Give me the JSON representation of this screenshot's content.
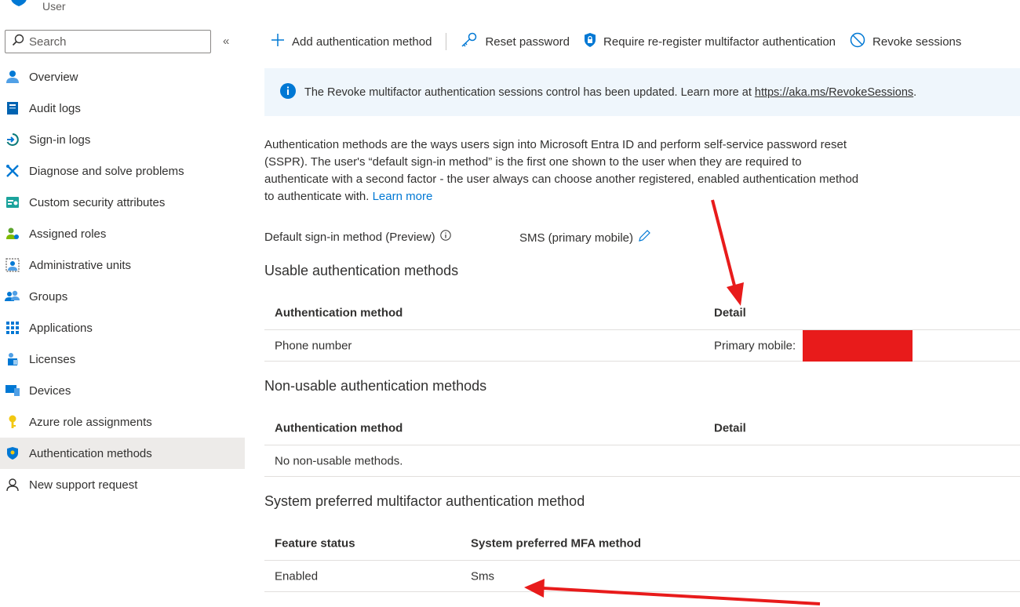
{
  "header": {
    "subtitle": "User"
  },
  "sidebar": {
    "search_placeholder": "Search",
    "collapse_glyph": "«",
    "items": [
      {
        "label": "Overview",
        "icon": "person-icon"
      },
      {
        "label": "Audit logs",
        "icon": "audit-log-icon"
      },
      {
        "label": "Sign-in logs",
        "icon": "sign-in-icon"
      },
      {
        "label": "Diagnose and solve problems",
        "icon": "wrench-icon"
      },
      {
        "label": "Custom security attributes",
        "icon": "attribute-card-icon"
      },
      {
        "label": "Assigned roles",
        "icon": "roles-icon"
      },
      {
        "label": "Administrative units",
        "icon": "admin-units-icon"
      },
      {
        "label": "Groups",
        "icon": "groups-icon"
      },
      {
        "label": "Applications",
        "icon": "apps-grid-icon"
      },
      {
        "label": "Licenses",
        "icon": "license-icon"
      },
      {
        "label": "Devices",
        "icon": "device-icon"
      },
      {
        "label": "Azure role assignments",
        "icon": "key-icon"
      },
      {
        "label": "Authentication methods",
        "icon": "auth-shield-icon",
        "active": true
      },
      {
        "label": "New support request",
        "icon": "support-person-icon"
      }
    ]
  },
  "toolbar": {
    "add": "Add authentication method",
    "reset": "Reset password",
    "require": "Require re-register multifactor authentication",
    "revoke": "Revoke sessions"
  },
  "banner": {
    "text": "The Revoke multifactor authentication sessions control has been updated. Learn more at",
    "link": "https://aka.ms/RevokeSessions",
    "trailing": "."
  },
  "description": {
    "text": "Authentication methods are the ways users sign into Microsoft Entra ID and perform self-service password reset (SSPR). The user's “default sign-in method” is the first one shown to the user when they are required to authenticate with a second factor - the user always can choose another registered, enabled authentication method to authenticate with.",
    "link": "Learn more"
  },
  "default_signin": {
    "label": "Default sign-in method (Preview)",
    "value": "SMS (primary mobile)"
  },
  "usable": {
    "title": "Usable authentication methods",
    "headers": [
      "Authentication method",
      "Detail"
    ],
    "rows": [
      {
        "method": "Phone number",
        "detail": "Primary mobile:"
      }
    ]
  },
  "non_usable": {
    "title": "Non-usable authentication methods",
    "headers": [
      "Authentication method",
      "Detail"
    ],
    "empty": "No non-usable methods."
  },
  "system_preferred": {
    "title": "System preferred multifactor authentication method",
    "headers": [
      "Feature status",
      "System preferred MFA method"
    ],
    "rows": [
      {
        "status": "Enabled",
        "method": "Sms"
      }
    ]
  },
  "colors": {
    "accent": "#0078d4",
    "annotation": "#e81b1b",
    "banner_bg": "#eff6fc",
    "active_nav_bg": "#edebe9"
  }
}
